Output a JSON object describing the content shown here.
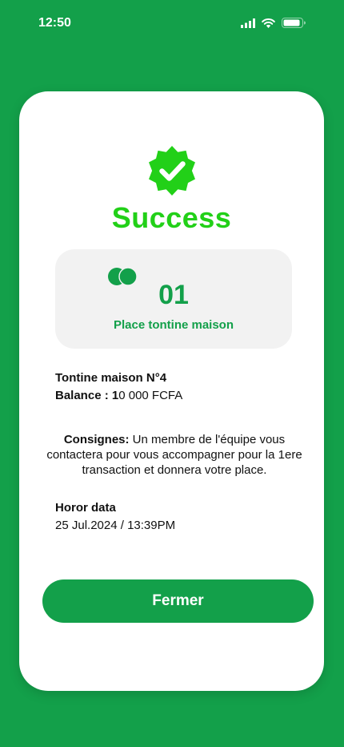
{
  "status_bar": {
    "time": "12:50",
    "icons": [
      "signal-icon",
      "wifi-icon",
      "battery-icon"
    ]
  },
  "card": {
    "badge_icon": "verified-check-icon",
    "title": "Success",
    "place": {
      "icon": "coins-icon",
      "number": "01",
      "label": "Place tontine maison"
    },
    "tontine_name": "Tontine maison N°4",
    "balance_label": "Balance : ",
    "balance_value_bold": "1",
    "balance_value_rest": "0 000 FCFA",
    "consignes_label": "Consignes:",
    "consignes_text": " Un membre de l'équipe vous contactera pour vous accompagner pour la 1ere transaction et donnera votre place.",
    "horor_label": "Horor data",
    "horor_value": "25 Jul.2024 / 13:39PM",
    "close_label": "Fermer"
  },
  "colors": {
    "background": "#13a04a",
    "accent_green": "#22d018",
    "button": "#13a04a",
    "place_box": "#f2f2f2"
  }
}
